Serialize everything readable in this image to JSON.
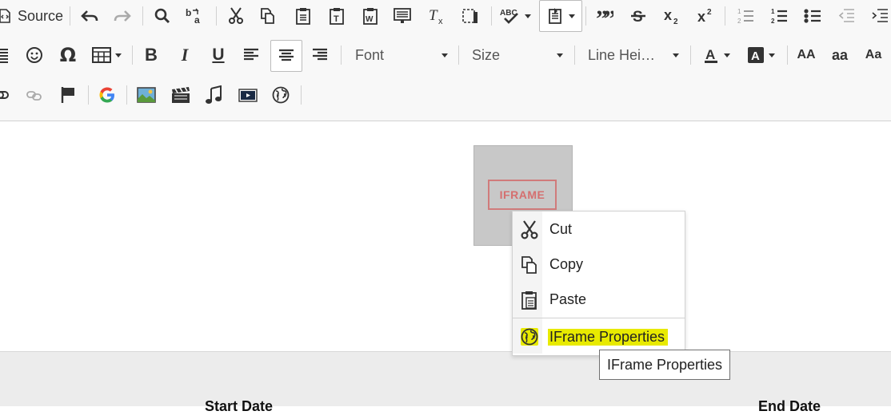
{
  "toolbar": {
    "source_label": "Source",
    "font_combo": "Font",
    "size_combo": "Size",
    "line_height_combo": "Line Hei…",
    "case_labels": [
      "AA",
      "aa",
      "Aa"
    ]
  },
  "editor": {
    "iframe_placeholder_label": "IFRAME"
  },
  "context_menu": {
    "items": [
      {
        "label": "Cut",
        "icon": "scissors-icon"
      },
      {
        "label": "Copy",
        "icon": "copy-icon"
      },
      {
        "label": "Paste",
        "icon": "paste-icon"
      },
      {
        "label": "IFrame Properties",
        "icon": "globe-icon",
        "highlighted": true
      }
    ]
  },
  "tooltip": {
    "text": "IFrame Properties"
  },
  "form": {
    "start_date_label": "Start Date",
    "end_date_label": "End Date"
  },
  "colors": {
    "highlight": "#e8ea00",
    "iframe_border": "#d07b7b",
    "toolbar_bg": "#f8f8f8"
  }
}
